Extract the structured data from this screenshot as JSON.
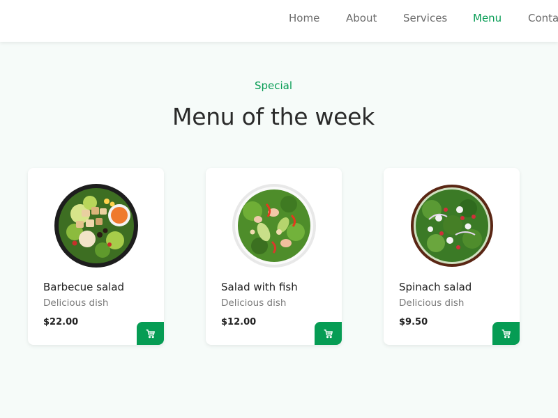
{
  "nav": {
    "items": [
      {
        "label": "Home"
      },
      {
        "label": "About"
      },
      {
        "label": "Services"
      },
      {
        "label": "Menu"
      },
      {
        "label": "Contact"
      }
    ],
    "active_index": 3
  },
  "section": {
    "subtitle": "Special",
    "title": "Menu of the week"
  },
  "menu": [
    {
      "name": "Barbecue salad",
      "description": "Delicious dish",
      "price": "$22.00",
      "image_icon": "barbecue-salad-bowl"
    },
    {
      "name": "Salad with fish",
      "description": "Delicious dish",
      "price": "$12.00",
      "image_icon": "fish-salad-bowl"
    },
    {
      "name": "Spinach salad",
      "description": "Delicious dish",
      "price": "$9.50",
      "image_icon": "spinach-salad-bowl"
    }
  ],
  "colors": {
    "accent": "#069c54",
    "background": "#f6fbf9",
    "card": "#ffffff"
  },
  "icons": {
    "cart": "shopping-cart-icon"
  }
}
